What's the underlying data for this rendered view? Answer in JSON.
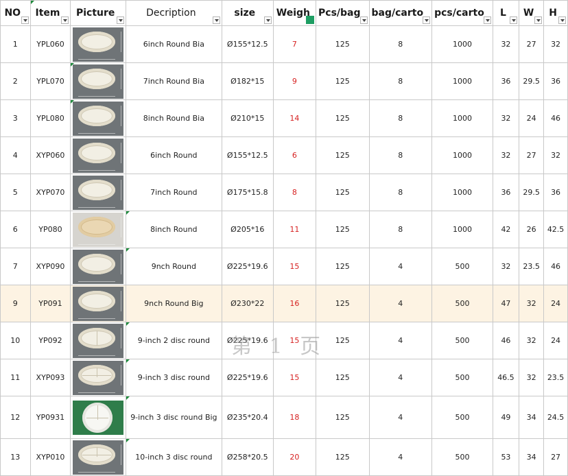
{
  "sheet": {
    "headers": [
      {
        "key": "no",
        "label": "NO",
        "filter": "normal"
      },
      {
        "key": "item",
        "label": "Item",
        "filter": "normal"
      },
      {
        "key": "picture",
        "label": "Picture",
        "filter": "normal"
      },
      {
        "key": "description",
        "label": "Decription",
        "filter": "normal"
      },
      {
        "key": "size",
        "label": "size",
        "filter": "normal"
      },
      {
        "key": "weight",
        "label": "Weigh",
        "filter": "active"
      },
      {
        "key": "pcs_bag",
        "label": "Pcs/bag",
        "filter": "normal"
      },
      {
        "key": "bag_carton",
        "label": "bag/carto",
        "filter": "normal"
      },
      {
        "key": "pcs_carton",
        "label": "pcs/carto",
        "filter": "normal"
      },
      {
        "key": "l",
        "label": "L",
        "filter": "normal"
      },
      {
        "key": "w",
        "label": "W",
        "filter": "normal"
      },
      {
        "key": "h",
        "label": "H",
        "filter": "normal"
      }
    ],
    "active_filter_glyph": "T",
    "rows": [
      {
        "no": "1",
        "item": "YPL060",
        "picture": "plate-oval",
        "description": "6inch Round Bia",
        "size": "Ø155*12.5",
        "weight": "7",
        "pcs_bag": "125",
        "bag_carton": "8",
        "pcs_carton": "1000",
        "l": "32",
        "w": "27",
        "h": "32"
      },
      {
        "no": "2",
        "item": "YPL070",
        "picture": "plate-oval",
        "description": "7inch Round Bia",
        "size": "Ø182*15",
        "weight": "9",
        "pcs_bag": "125",
        "bag_carton": "8",
        "pcs_carton": "1000",
        "l": "36",
        "w": "29.5",
        "h": "36"
      },
      {
        "no": "3",
        "item": "YPL080",
        "picture": "plate-oval",
        "description": "8inch Round Bia",
        "size": "Ø210*15",
        "weight": "14",
        "pcs_bag": "125",
        "bag_carton": "8",
        "pcs_carton": "1000",
        "l": "32",
        "w": "24",
        "h": "46"
      },
      {
        "no": "4",
        "item": "XYP060",
        "picture": "plate-oval",
        "description": "6inch Round",
        "size": "Ø155*12.5",
        "weight": "6",
        "pcs_bag": "125",
        "bag_carton": "8",
        "pcs_carton": "1000",
        "l": "32",
        "w": "27",
        "h": "32"
      },
      {
        "no": "5",
        "item": "XYP070",
        "picture": "plate-oval",
        "description": "7inch Round",
        "size": "Ø175*15.8",
        "weight": "8",
        "pcs_bag": "125",
        "bag_carton": "8",
        "pcs_carton": "1000",
        "l": "36",
        "w": "29.5",
        "h": "36"
      },
      {
        "no": "6",
        "item": "YP080",
        "picture": "plate-beige",
        "description": "8inch Round",
        "size": "Ø205*16",
        "weight": "11",
        "pcs_bag": "125",
        "bag_carton": "8",
        "pcs_carton": "1000",
        "l": "42",
        "w": "26",
        "h": "42.5"
      },
      {
        "no": "7",
        "item": "XYP090",
        "picture": "plate-oval",
        "description": "9nch Round",
        "size": "Ø225*19.6",
        "weight": "15",
        "pcs_bag": "125",
        "bag_carton": "4",
        "pcs_carton": "500",
        "l": "32",
        "w": "23.5",
        "h": "46"
      },
      {
        "no": "9",
        "item": "YP091",
        "picture": "plate-oval",
        "description": "9nch Round Big",
        "size": "Ø230*22",
        "weight": "16",
        "pcs_bag": "125",
        "bag_carton": "4",
        "pcs_carton": "500",
        "l": "47",
        "w": "32",
        "h": "24"
      },
      {
        "no": "10",
        "item": "YP092",
        "picture": "plate-2disc",
        "description": "9-inch 2 disc round",
        "size": "Ø225*19.6",
        "weight": "15",
        "pcs_bag": "125",
        "bag_carton": "4",
        "pcs_carton": "500",
        "l": "46",
        "w": "32",
        "h": "24"
      },
      {
        "no": "11",
        "item": "XYP093",
        "picture": "plate-3disc",
        "description": "9-inch 3 disc round",
        "size": "Ø225*19.6",
        "weight": "15",
        "pcs_bag": "125",
        "bag_carton": "4",
        "pcs_carton": "500",
        "l": "46.5",
        "w": "32",
        "h": "23.5"
      },
      {
        "no": "12",
        "item": "YP0931",
        "picture": "plate-3disc-green",
        "description": "9-inch 3 disc round  Big",
        "size": "Ø235*20.4",
        "weight": "18",
        "pcs_bag": "125",
        "bag_carton": "4",
        "pcs_carton": "500",
        "l": "49",
        "w": "34",
        "h": "24.5"
      },
      {
        "no": "13",
        "item": "XYP010",
        "picture": "plate-3disc",
        "description": "10-inch 3 disc round",
        "size": "Ø258*20.5",
        "weight": "20",
        "pcs_bag": "125",
        "bag_carton": "4",
        "pcs_carton": "500",
        "l": "53",
        "w": "34",
        "h": "27"
      }
    ]
  },
  "watermark": "第 1 页",
  "colors": {
    "weight_text": "#d62020",
    "highlight_row": "#fdf3e3",
    "filter_active": "#1e9e63",
    "comment_marker": "#1e8a3c"
  }
}
